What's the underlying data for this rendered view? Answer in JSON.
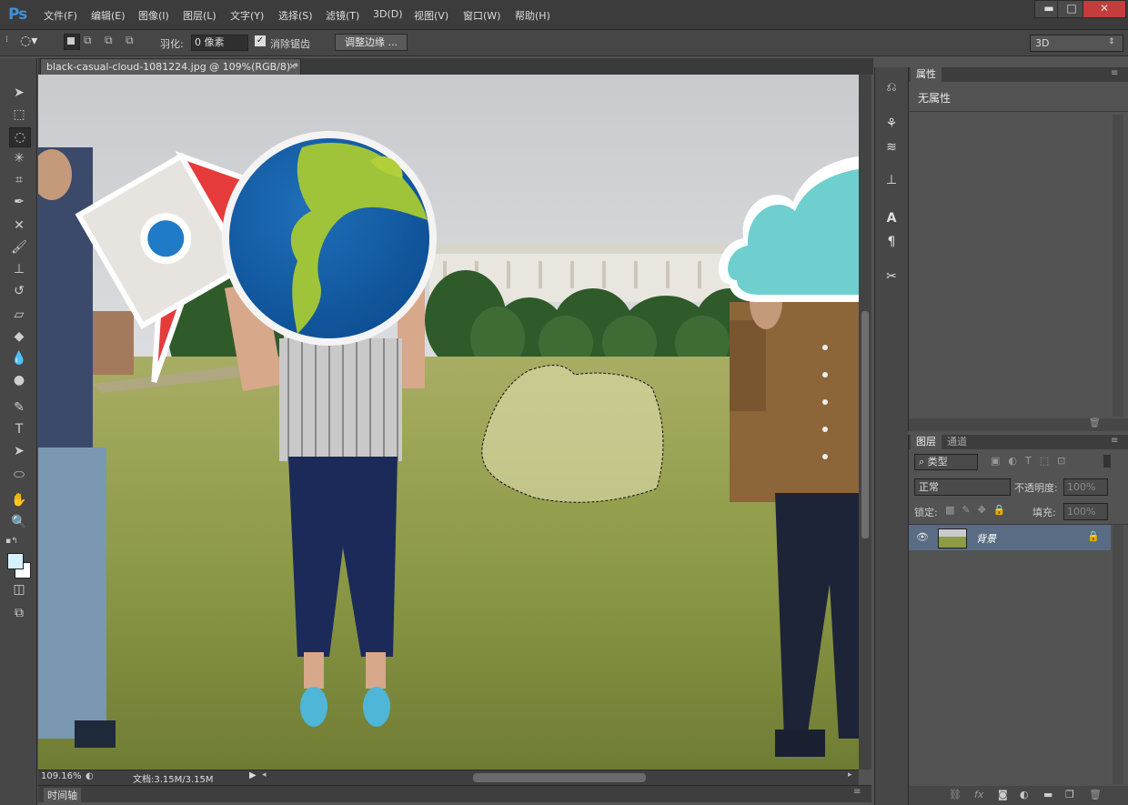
{
  "app": {
    "logo": "Ps"
  },
  "menu": [
    "文件(F)",
    "编辑(E)",
    "图像(I)",
    "图层(L)",
    "文字(Y)",
    "选择(S)",
    "滤镜(T)",
    "3D(D)",
    "视图(V)",
    "窗口(W)",
    "帮助(H)"
  ],
  "window_controls": {
    "minimize": "▬",
    "maximize": "□",
    "close": "✕"
  },
  "options": {
    "feather_label": "羽化:",
    "feather_value": "0 像素",
    "antialias_label": "消除锯齿",
    "antialias_checked": "✓",
    "refine_edge": "调整边缘 ...",
    "workspace": "3D"
  },
  "document": {
    "tab_title": "black-casual-cloud-1081224.jpg @ 109%(RGB/8) *",
    "tab_close": "×",
    "zoom": "109.16%",
    "doc_size": "文档:3.15M/3.15M"
  },
  "timeline": {
    "label": "时间轴"
  },
  "properties": {
    "tab": "属性",
    "content": "无属性"
  },
  "layers": {
    "tabs": [
      "图层",
      "通道"
    ],
    "filter_kind": "类型",
    "blend_mode": "正常",
    "opacity_label": "不透明度:",
    "opacity_value": "100%",
    "lock_label": "锁定:",
    "fill_label": "填充:",
    "fill_value": "100%",
    "items": [
      {
        "name": "背景",
        "locked": true,
        "visible": true
      }
    ]
  },
  "colors": {
    "accent_blue": "#3f8fd8",
    "layer_selected": "#5a6b84",
    "foreground_swatch": "#d6f2ff",
    "background_swatch": "#ffffff"
  }
}
